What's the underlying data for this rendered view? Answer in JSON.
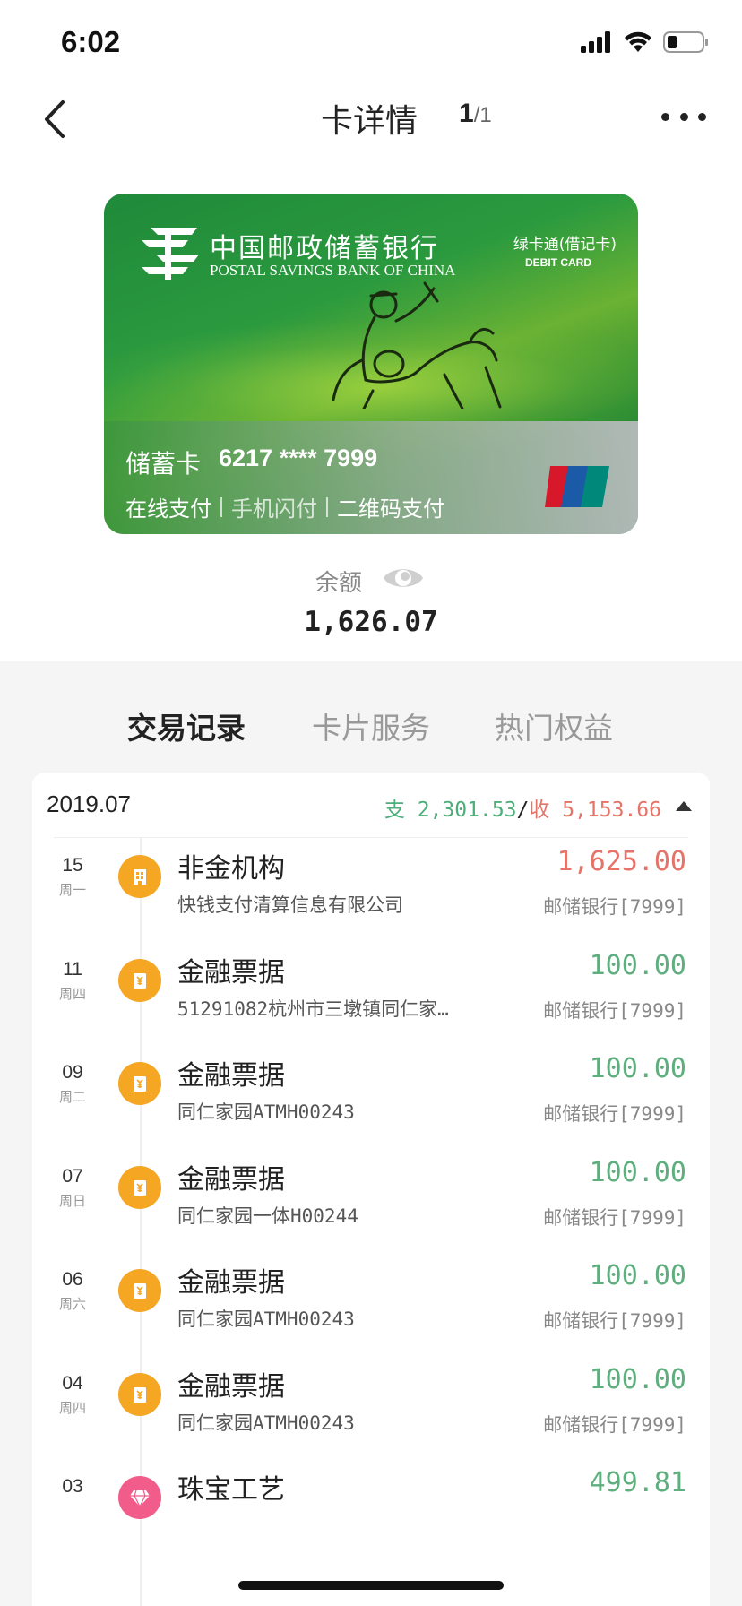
{
  "status_bar": {
    "time": "6:02"
  },
  "nav": {
    "title": "卡详情",
    "page_current": "1",
    "page_total": "/1"
  },
  "card": {
    "bank_name_cn": "中国邮政储蓄银行",
    "bank_name_en": "POSTAL SAVINGS BANK OF CHINA",
    "card_product_cn": "绿卡通(借记卡)",
    "card_product_en": "DEBIT CARD",
    "card_label": "储蓄卡",
    "card_number": "6217 **** 7999",
    "features": [
      "在线支付",
      "手机闪付",
      "二维码支付"
    ],
    "brand_colors": {
      "green": "#2b9a3e",
      "unionpay_red": "#d7182a",
      "unionpay_blue": "#1a5aa6",
      "unionpay_teal": "#00897b"
    }
  },
  "balance": {
    "label": "余额",
    "value": "1,626.07"
  },
  "tabs": [
    {
      "label": "交易记录",
      "active": true
    },
    {
      "label": "卡片服务",
      "active": false
    },
    {
      "label": "热门权益",
      "active": false
    }
  ],
  "month_group": {
    "month": "2019.07",
    "out_label": "支 2,301.53",
    "separator": "/",
    "in_label": "收 5,153.66"
  },
  "transactions": [
    {
      "day": "15",
      "weekday": "周一",
      "name": "非金机构",
      "desc": "快钱支付清算信息有限公司",
      "amount": "1,625.00",
      "direction": "in",
      "account": "邮储银行[7999]",
      "icon": "building-icon"
    },
    {
      "day": "11",
      "weekday": "周四",
      "name": "金融票据",
      "desc": "51291082杭州市三墩镇同仁家…",
      "amount": "100.00",
      "direction": "out",
      "account": "邮储银行[7999]",
      "icon": "bill-icon"
    },
    {
      "day": "09",
      "weekday": "周二",
      "name": "金融票据",
      "desc": "同仁家园ATMH00243",
      "amount": "100.00",
      "direction": "out",
      "account": "邮储银行[7999]",
      "icon": "bill-icon"
    },
    {
      "day": "07",
      "weekday": "周日",
      "name": "金融票据",
      "desc": "同仁家园一体H00244",
      "amount": "100.00",
      "direction": "out",
      "account": "邮储银行[7999]",
      "icon": "bill-icon"
    },
    {
      "day": "06",
      "weekday": "周六",
      "name": "金融票据",
      "desc": "同仁家园ATMH00243",
      "amount": "100.00",
      "direction": "out",
      "account": "邮储银行[7999]",
      "icon": "bill-icon"
    },
    {
      "day": "04",
      "weekday": "周四",
      "name": "金融票据",
      "desc": "同仁家园ATMH00243",
      "amount": "100.00",
      "direction": "out",
      "account": "邮储银行[7999]",
      "icon": "bill-icon"
    },
    {
      "day": "03",
      "weekday": "",
      "name": "珠宝工艺",
      "desc": "",
      "amount": "499.81",
      "direction": "out",
      "account": "",
      "icon": "diamond-icon"
    }
  ]
}
